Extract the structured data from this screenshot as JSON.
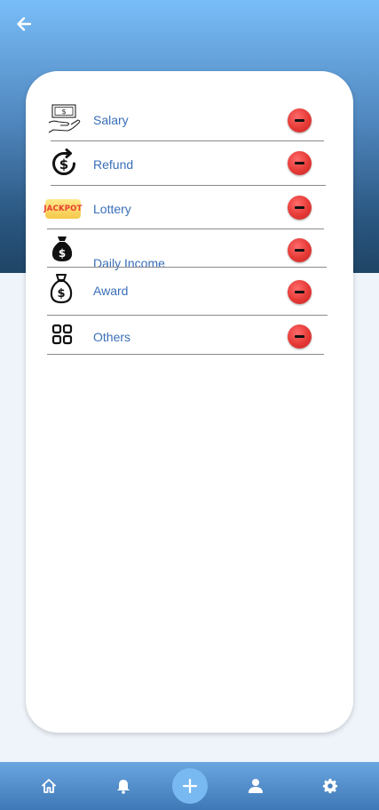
{
  "header": {
    "back_icon": "arrow-left-icon"
  },
  "categories": [
    {
      "label": "Salary",
      "icon": "salary-hand-icon"
    },
    {
      "label": "Refund",
      "icon": "refund-icon"
    },
    {
      "label": "Lottery",
      "icon": "jackpot-icon",
      "icon_text": "JACKPOT"
    },
    {
      "label": "Daily Income",
      "icon": "money-bag-icon"
    },
    {
      "label": "Award",
      "icon": "money-bag-outline-icon"
    },
    {
      "label": "Others",
      "icon": "grid-icon"
    }
  ],
  "bottom_nav": {
    "items": [
      "home-icon",
      "bell-icon",
      "plus-icon",
      "user-icon",
      "gear-icon"
    ]
  },
  "colors": {
    "accent": "#3a6fb8",
    "delete": "#e53935",
    "nav": "#4a86c4"
  }
}
